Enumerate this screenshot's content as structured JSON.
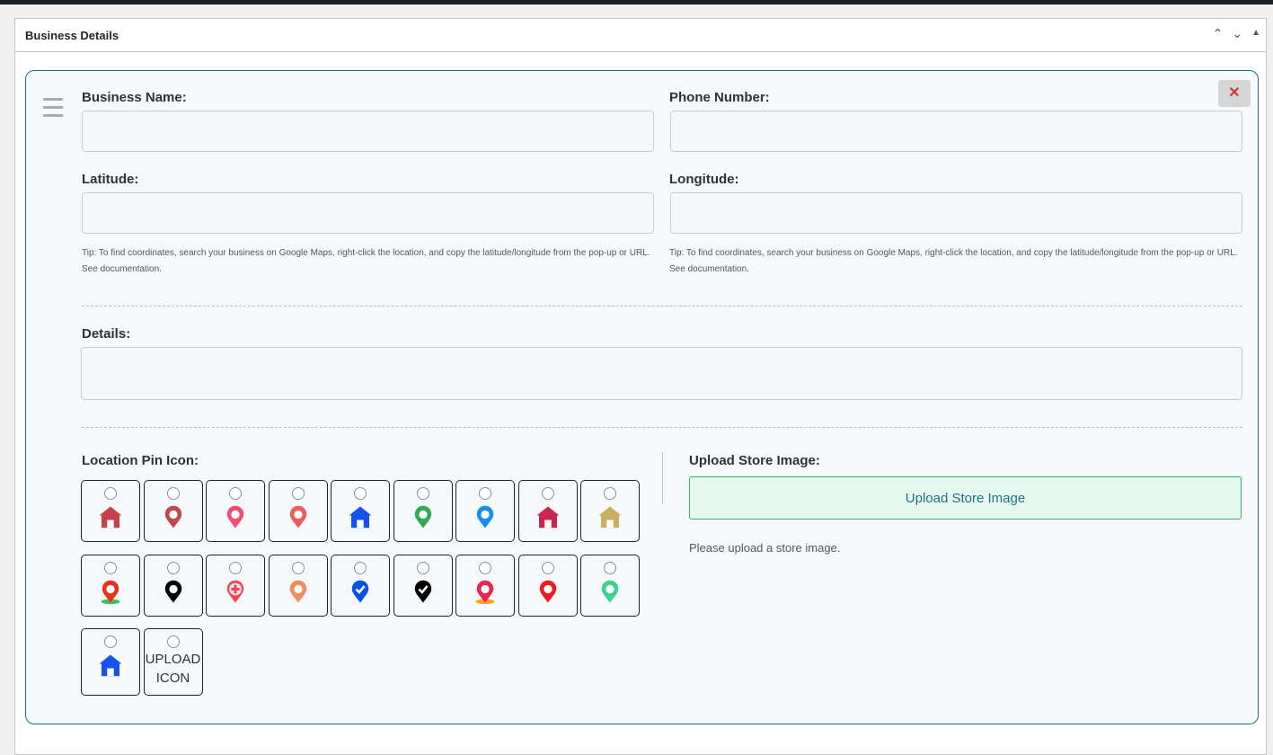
{
  "panel": {
    "title": "Business Details",
    "move_up": "⌃",
    "move_down": "⌄",
    "toggle": "▲"
  },
  "card": {
    "close_label": "✕"
  },
  "fields": {
    "business_name": {
      "label": "Business Name:",
      "value": ""
    },
    "phone": {
      "label": "Phone Number:",
      "value": ""
    },
    "latitude": {
      "label": "Latitude:",
      "value": ""
    },
    "longitude": {
      "label": "Longitude:",
      "value": ""
    },
    "tip1": "Tip: To find coordinates, search your business on Google Maps, right-click the location, and copy the latitude/longitude from the pop-up or URL.",
    "tip2": "See documentation.",
    "details": {
      "label": "Details:",
      "value": ""
    }
  },
  "pins": {
    "label": "Location Pin Icon:",
    "upload_icon_label": "UPLOAD ICON",
    "icons": [
      {
        "name": "house-gear",
        "color": "#c9404a"
      },
      {
        "name": "pin-ripple",
        "color": "#c0474f"
      },
      {
        "name": "pin-pink",
        "color": "#ef4f73"
      },
      {
        "name": "pin-wrench",
        "color": "#ee5b5b"
      },
      {
        "name": "storefront",
        "color": "#1652f0"
      },
      {
        "name": "google-maps-pin",
        "color": "#34a853"
      },
      {
        "name": "pin-blue",
        "color": "#1a8cf0"
      },
      {
        "name": "pin-house",
        "color": "#c8254f"
      },
      {
        "name": "house-3d",
        "color": "#c8b060"
      },
      {
        "name": "pin-red-ground",
        "color": "#e8321f"
      },
      {
        "name": "pin-black",
        "color": "#000000"
      },
      {
        "name": "pin-medical",
        "color": "#ef4650"
      },
      {
        "name": "pin-orange",
        "color": "#f58a5c"
      },
      {
        "name": "pin-blue-check",
        "color": "#0a4fe8"
      },
      {
        "name": "pin-black-check",
        "color": "#000000"
      },
      {
        "name": "pin-navigation",
        "color": "#e8264f"
      },
      {
        "name": "pin-red",
        "color": "#ef1c24"
      },
      {
        "name": "pin-green",
        "color": "#3fcf8e"
      },
      {
        "name": "store-gear",
        "color": "#1652f0"
      }
    ]
  },
  "upload": {
    "label": "Upload Store Image:",
    "button": "Upload Store Image",
    "help": "Please upload a store image."
  }
}
